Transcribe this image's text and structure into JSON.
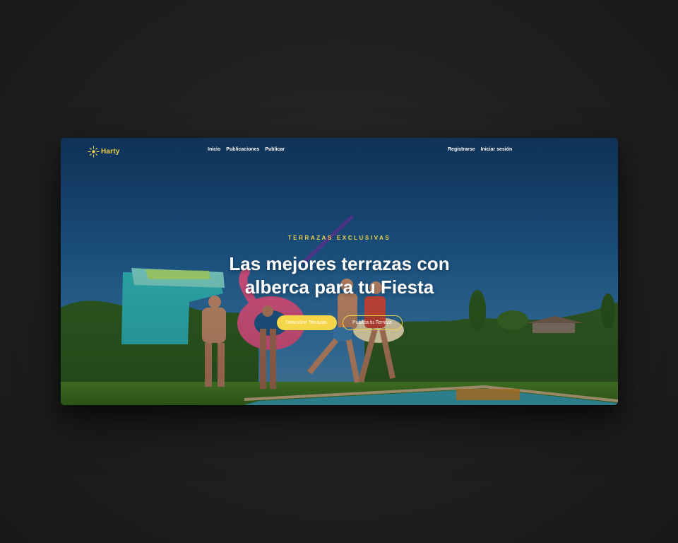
{
  "brand": {
    "name": "Harty"
  },
  "nav": {
    "links": [
      "Inicio",
      "Publicaciones",
      "Publicar"
    ],
    "auth": [
      "Registrarse",
      "Iniciar sesión"
    ]
  },
  "hero": {
    "eyebrow": "TERRAZAS EXCLUSIVAS",
    "title_line1": "Las mejores terrazas con",
    "title_line2": "alberca para tu Fiesta",
    "primary_button": "Descubre Terrazas",
    "secondary_button": "Publica tu Terraza"
  },
  "colors": {
    "accent": "#f5d548",
    "background": "#1f1f1f",
    "sky": "#1b4f7c"
  }
}
